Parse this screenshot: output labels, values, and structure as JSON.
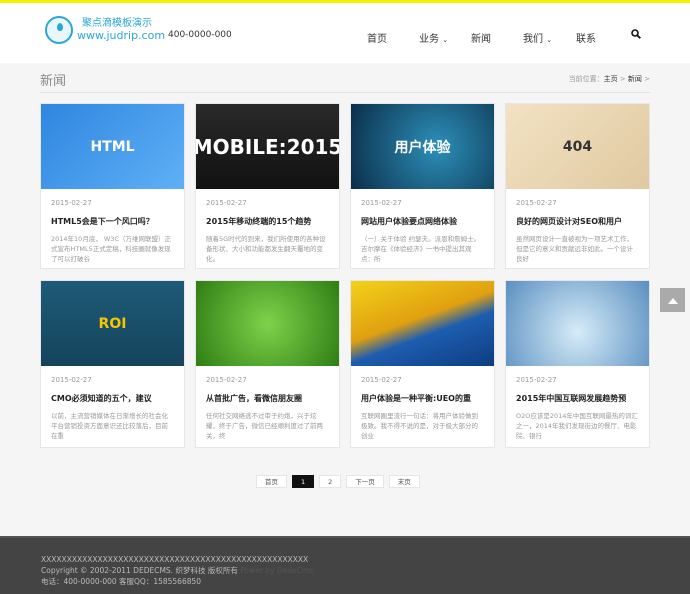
{
  "header": {
    "logo_cn": "聚点滴模板演示",
    "logo_en": "www.judrip.com",
    "phone": "400-0000-000",
    "nav": [
      {
        "label": "首页"
      },
      {
        "label": "业务"
      },
      {
        "label": "新闻"
      },
      {
        "label": "我们"
      },
      {
        "label": "联系"
      }
    ]
  },
  "page": {
    "title": "新闻",
    "crumb_prefix": "当前位置：",
    "crumb_home": "主页",
    "crumb_sep": " > ",
    "crumb_current": "新闻",
    "crumb_end": " >"
  },
  "articles": [
    {
      "img_text": "HTML",
      "date": "2015-02-27",
      "title": "HTML5会是下一个风口吗？",
      "desc": "2014年10月底， W3C（万维网联盟）正式宣布HTML5正式定稿，科技圈就像发现了可以打破谷"
    },
    {
      "img_text": "MOBILE:2015",
      "date": "2015-02-27",
      "title": "2015年移动终端的15个趋势",
      "desc": "随着5G时代的到来，我们所使用的各种设备形状、大小和功能都发生翻天覆地的变化。"
    },
    {
      "img_text": "用户体验",
      "date": "2015-02-27",
      "title": "网站用户体验要点网络体验",
      "desc": "（一）关于体验 约瑟夫。派恩和詹姆士。吉尔摩在《体验经济》一书中提出其观点：所"
    },
    {
      "img_text": "404",
      "date": "2015-02-27",
      "title": "良好的网页设计对SEO和用户",
      "desc": "虽然网页设计一直被视为一项艺术工作，但是它的意义和贡献远非如此。一个设计良好"
    },
    {
      "img_text": "ROI",
      "date": "2015-02-27",
      "title": "CMO必须知道的五个，建议",
      "desc": "以前，主流营销媒体在日渐增长的社会化平台营销投资方面意识还比较落后，目前在重"
    },
    {
      "img_text": "",
      "date": "2015-02-27",
      "title": "从首批广告，看微信朋友圈",
      "desc": "任何社交网络逃不过审于约炮，兴于炫耀，终于广告，微信已经顺利度过了前两关，终"
    },
    {
      "img_text": "",
      "date": "2015-02-27",
      "title": "用户体验是一种平衡:UEO的重",
      "desc": "互联网圈里流行一句话：将用户体验做到极致。我不得不说的是，对于极大部分的创业"
    },
    {
      "img_text": "",
      "date": "2015-02-27",
      "title": "2015年中国互联网发展趋势预",
      "desc": "O2O应该是2014年中国互联网最热的词汇之一，2014年我们发现街边的餐厅、电影院、银行"
    }
  ],
  "pager": {
    "first": "首页",
    "p1": "1",
    "p2": "2",
    "next": "下一页",
    "last": "末页"
  },
  "footer": {
    "line1": "XXXXXXXXXXXXXXXXXXXXXXXXXXXXXXXXXXXXXXXXXXXXXXXXXXXX",
    "copyright": "Copyright © 2002-2011 DEDECMS. 织梦科技 版权所有",
    "power": "Power by DedeCms",
    "contact": "电话：400-0000-000 客服QQ：1585566850"
  }
}
